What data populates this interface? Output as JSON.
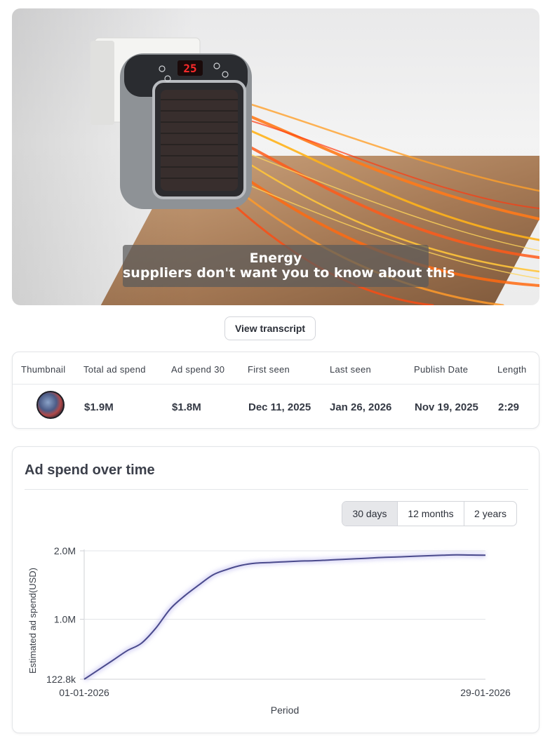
{
  "video": {
    "caption_line1": "Energy",
    "caption_line2": "suppliers don't want you to know about this",
    "heater_display": "25"
  },
  "transcript_button": "View transcript",
  "stats": {
    "headers": [
      "Thumbnail",
      "Total ad spend",
      "Ad spend 30",
      "First seen",
      "Last seen",
      "Publish Date",
      "Length"
    ],
    "values": {
      "total_ad_spend": "$1.9M",
      "ad_spend_30": "$1.8M",
      "first_seen": "Dec 11, 2025",
      "last_seen": "Jan 26, 2026",
      "publish_date": "Nov 19, 2025",
      "length": "2:29"
    }
  },
  "chart_section": {
    "title": "Ad spend over time",
    "ranges": [
      {
        "label": "30 days",
        "active": true
      },
      {
        "label": "12 months",
        "active": false
      },
      {
        "label": "2 years",
        "active": false
      }
    ]
  },
  "chart_data": {
    "type": "line",
    "title": "",
    "xlabel": "Period",
    "ylabel": "Estimated ad spend(USD)",
    "x_tick_labels": [
      "01-01-2026",
      "29-01-2026"
    ],
    "y_tick_labels": [
      "122.8k",
      "1.0M",
      "2.0M"
    ],
    "y_ticks": [
      122800,
      1000000,
      2000000
    ],
    "ylim": [
      122800,
      2000000
    ],
    "grid": true,
    "legend": "none",
    "line_color": "#4a4a8c",
    "x": [
      "01-01-2026",
      "02-01-2026",
      "03-01-2026",
      "04-01-2026",
      "05-01-2026",
      "06-01-2026",
      "07-01-2026",
      "08-01-2026",
      "09-01-2026",
      "10-01-2026",
      "11-01-2026",
      "12-01-2026",
      "13-01-2026",
      "14-01-2026",
      "15-01-2026",
      "16-01-2026",
      "17-01-2026",
      "18-01-2026",
      "19-01-2026",
      "20-01-2026",
      "21-01-2026",
      "22-01-2026",
      "23-01-2026",
      "24-01-2026",
      "25-01-2026",
      "26-01-2026",
      "27-01-2026",
      "28-01-2026",
      "29-01-2026"
    ],
    "series": [
      {
        "values": [
          122800,
          260000,
          400000,
          540000,
          650000,
          870000,
          1150000,
          1340000,
          1500000,
          1650000,
          1730000,
          1790000,
          1820000,
          1830000,
          1840000,
          1850000,
          1855000,
          1865000,
          1875000,
          1885000,
          1895000,
          1905000,
          1912000,
          1920000,
          1928000,
          1935000,
          1940000,
          1938000,
          1935000
        ]
      }
    ]
  }
}
